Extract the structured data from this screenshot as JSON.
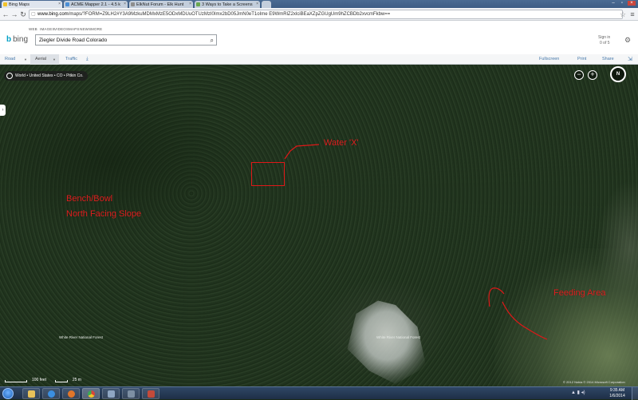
{
  "browser": {
    "tabs": [
      {
        "title": "Bing Maps",
        "active": true,
        "favicon_color": "#f3c42a"
      },
      {
        "title": "ACME Mapper 2.1 - 4.5 k",
        "active": false,
        "favicon_color": "#4a8fd6"
      },
      {
        "title": "ElkNut Forum - Elk Hunt",
        "active": false,
        "favicon_color": "#8e8e8e"
      },
      {
        "title": "3 Ways to Take a Screens",
        "active": false,
        "favicon_color": "#6aa84f"
      }
    ],
    "url_host": "www.bing.com",
    "url_rest": "/maps/?FORM=Z9LH2#Y3A9MzkuMDMxMzE5ODxMDUuOTUzMzI0Imx2bD05JmN0eT1oIme E9WmRlZ2xlciBEaXZpZGUgUm9hZCBDb2xvcmFkbw=="
  },
  "bing": {
    "nav": [
      "WEB",
      "IMAGES",
      "VIDEOS",
      "MAPS",
      "NEWS",
      "MORE"
    ],
    "logo_text": "bing",
    "search_value": "Ziegler Divide Road Colorado",
    "signin": "Sign in",
    "signin_sub": "0 of 5"
  },
  "map_toolbar": {
    "road": "Road",
    "aerial": "Aerial",
    "traffic": "Traffic",
    "download": "⤓",
    "fullscreen": "Fullscreen",
    "print": "Print",
    "share": "Share"
  },
  "map": {
    "breadcrumb": "World • United States • CO • Pitkin Co.",
    "compass": "N",
    "zoom_out": "−",
    "zoom_in": "+",
    "annotations": {
      "water": "Water 'X'",
      "bench_line1": "Bench/Bowl",
      "bench_line2": "North Facing Slope",
      "feeding": "Feeding Area"
    },
    "forest_label_1": "White River National Forest",
    "forest_label_2": "White River National Forest",
    "scale_feet": "100 feet",
    "scale_meters": "25 m",
    "copyright": "© 2012 Nokia  © 2014 Microsoft Corporation",
    "annotation_color": "#e02020"
  },
  "taskbar": {
    "apps": [
      {
        "name": "file-explorer-icon",
        "color": "#e8c15a"
      },
      {
        "name": "internet-explorer-icon",
        "color": "#3b8fe0"
      },
      {
        "name": "media-player-icon",
        "color": "#e0762a"
      },
      {
        "name": "chrome-icon",
        "color": "#d9453a"
      },
      {
        "name": "window-app-icon",
        "color": "#8fa6c2"
      },
      {
        "name": "calculator-icon",
        "color": "#7d8fa3"
      },
      {
        "name": "snipping-tool-icon",
        "color": "#c44a3a"
      }
    ],
    "time": "9:35 AM",
    "date": "1/6/2014"
  }
}
